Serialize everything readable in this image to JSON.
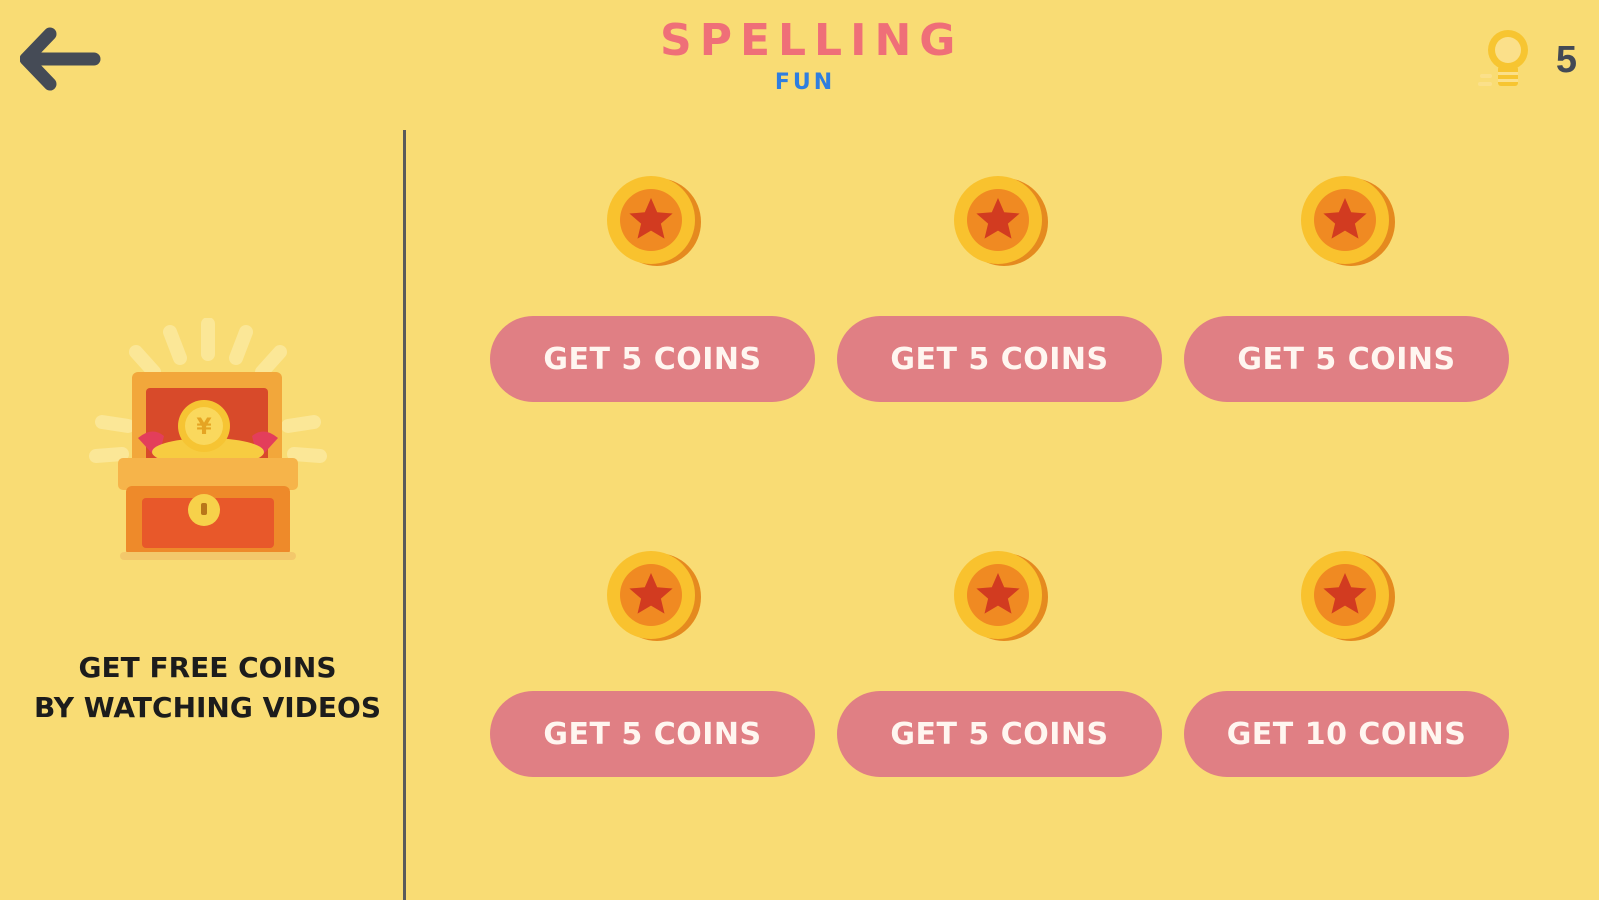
{
  "header": {
    "back_icon": "arrow-left-icon",
    "logo_main": "SPELLING",
    "logo_sub": "FUN",
    "balance_icon": "light-bulb-icon",
    "balance_count": "5"
  },
  "promo": {
    "icon": "treasure-chest-icon",
    "line1": "GET FREE COINS",
    "line2": "BY WATCHING VIDEOS"
  },
  "offers": [
    {
      "icon": "star-coin-icon",
      "label": "GET 5 COINS"
    },
    {
      "icon": "star-coin-icon",
      "label": "GET 5 COINS"
    },
    {
      "icon": "star-coin-icon",
      "label": "GET 5 COINS"
    },
    {
      "icon": "star-coin-icon",
      "label": "GET 5 COINS"
    },
    {
      "icon": "star-coin-icon",
      "label": "GET 5 COINS"
    },
    {
      "icon": "star-coin-icon",
      "label": "GET 10 COINS"
    }
  ],
  "colors": {
    "background": "#f9dc74",
    "button": "#e07f84",
    "button_text": "#fff6f0",
    "logo_main": "#ef6f78",
    "logo_sub": "#2f7ee0"
  }
}
